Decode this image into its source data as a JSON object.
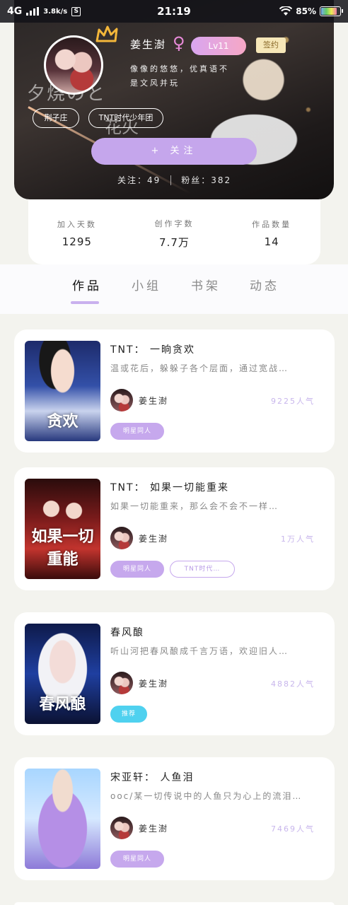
{
  "status_bar": {
    "network": "4G",
    "speed": "3.8k/s",
    "s_badge": "S",
    "time": "21:19",
    "battery": "85%",
    "battery_level": 0.85
  },
  "profile": {
    "username": "姜生澍",
    "gender_symbol": "♀",
    "level": "Lv11",
    "checkin_label": "签约",
    "signature": "像像的悠悠，优真语不是文风并玩",
    "banner_text": "夕烧のと",
    "banner_text2": "花火",
    "tags": [
      "荆子庄",
      "TNT时代少年团"
    ],
    "follow_label": "+ 关注",
    "following_label": "关注：49",
    "fans_label": "粉丝：382"
  },
  "info": [
    {
      "label": "加入天数",
      "value": "1295"
    },
    {
      "label": "创作字数",
      "value": "7.7万"
    },
    {
      "label": "作品数量",
      "value": "14"
    }
  ],
  "tabs": [
    "作品",
    "小组",
    "书架",
    "动态"
  ],
  "works": [
    {
      "title": "TNT：  一晌贪欢",
      "desc": "温或花后，躲躲子各个层面，通过宽战…",
      "author": "姜生澍",
      "popularity": "9225人气",
      "cover_text": "贪欢",
      "tags": [
        "明星同人"
      ]
    },
    {
      "title": "TNT：  如果一切能重来",
      "desc": "如果一切能重来，那么会不会不一样…",
      "author": "姜生澍",
      "popularity": "1万人气",
      "cover_text": "如果一切重能",
      "tags": [
        "明星同人",
        "TNT时代…"
      ]
    },
    {
      "title": "春风酿",
      "desc": "听山河把春风酿成千言万语，欢迎旧人…",
      "author": "姜生澍",
      "popularity": "4882人气",
      "cover_text": "春风酿",
      "tags": [
        "推荐"
      ]
    },
    {
      "title": "宋亚轩：  人鱼泪",
      "desc": "ooc/某一切传说中的人鱼只为心上的流泪…",
      "author": "姜生澍",
      "popularity": "7469人气",
      "cover_text": "",
      "tags": [
        "明星同人"
      ]
    }
  ],
  "colors": {
    "accent": "#c5a6ec",
    "page_bg": "#f3f3ee",
    "level_badge": "#e6a7dc",
    "chip_blue": "#4fd1ef"
  }
}
